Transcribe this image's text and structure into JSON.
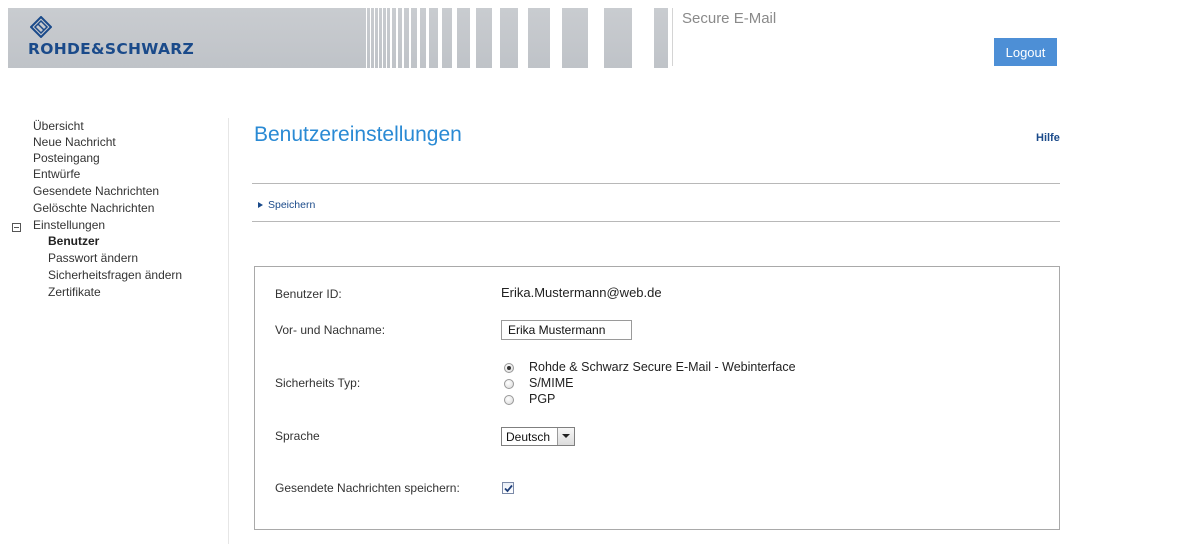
{
  "header": {
    "brand": "ROHDE&SCHWARZ",
    "app_title": "Secure E-Mail",
    "logout_label": "Logout"
  },
  "sidebar": {
    "items": [
      {
        "label": "Übersicht"
      },
      {
        "label": "Neue Nachricht"
      },
      {
        "label": "Posteingang"
      },
      {
        "label": "Entwürfe"
      },
      {
        "label": "Gesendete Nachrichten"
      },
      {
        "label": "Gelöschte Nachrichten"
      },
      {
        "label": "Einstellungen"
      }
    ],
    "sub_items": [
      {
        "label": "Benutzer",
        "active": true
      },
      {
        "label": "Passwort ändern"
      },
      {
        "label": "Sicherheitsfragen ändern"
      },
      {
        "label": "Zertifikate"
      }
    ]
  },
  "main": {
    "title": "Benutzereinstellungen",
    "help_label": "Hilfe",
    "save_label": "Speichern",
    "form": {
      "user_id_label": "Benutzer ID:",
      "user_id_value": "Erika.Mustermann@web.de",
      "name_label": "Vor- und Nachname:",
      "name_value": "Erika Mustermann",
      "security_label": "Sicherheits Typ:",
      "security_options": [
        {
          "label": "Rohde & Schwarz Secure E-Mail - Webinterface",
          "checked": true
        },
        {
          "label": "S/MIME",
          "checked": false
        },
        {
          "label": "PGP",
          "checked": false
        }
      ],
      "language_label": "Sprache",
      "language_value": "Deutsch",
      "save_sent_label": "Gesendete Nachrichten speichern:",
      "save_sent_checked": true
    }
  },
  "colors": {
    "accent": "#2a8ad4",
    "logout_bg": "#4d8fd6",
    "brand_blue": "#1a4a8a"
  }
}
